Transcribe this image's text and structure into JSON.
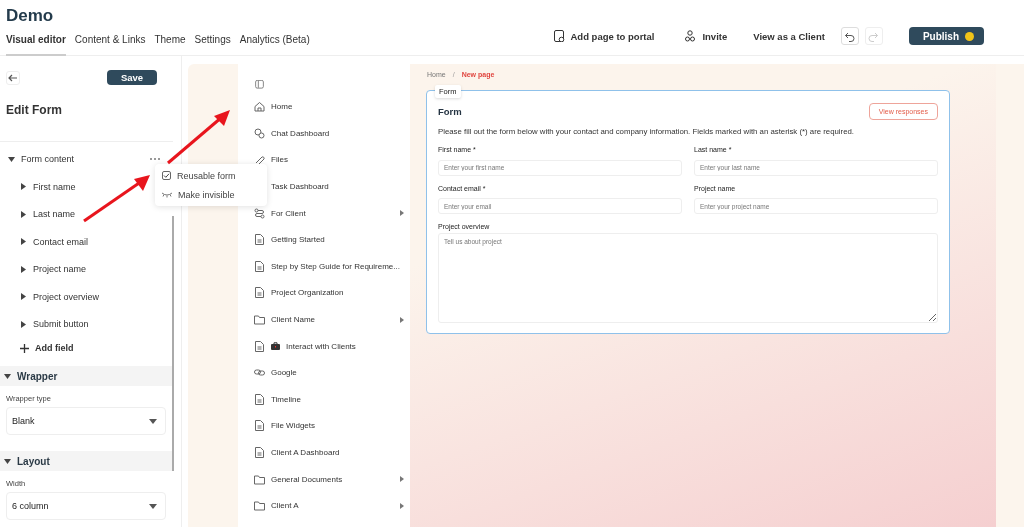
{
  "app": {
    "title": "Demo"
  },
  "tabs": [
    {
      "label": "Visual editor",
      "selected": true
    },
    {
      "label": "Content & Links",
      "selected": false
    },
    {
      "label": "Theme",
      "selected": false
    },
    {
      "label": "Settings",
      "selected": false
    },
    {
      "label": "Analytics (Beta)",
      "selected": false
    }
  ],
  "actions": [
    {
      "kind": "portal",
      "label": "Add page to portal"
    },
    {
      "kind": "invite",
      "label": "Invite"
    },
    {
      "kind": "plain",
      "label": "View as a Client"
    }
  ],
  "history": [
    {
      "kind": "undo",
      "disabled": false
    },
    {
      "kind": "redo",
      "disabled": true
    }
  ],
  "publish": {
    "label": "Publish",
    "color": "#f2c418"
  },
  "editor": {
    "save": "Save",
    "heading": "Edit Form",
    "tree": {
      "label": "Form content",
      "expanded": true,
      "children": [
        {
          "label": "First name",
          "expanded": false
        },
        {
          "label": "Last name",
          "expanded": false
        },
        {
          "label": "Contact email",
          "expanded": false
        },
        {
          "label": "Project name",
          "expanded": false
        },
        {
          "label": "Project overview",
          "expanded": false
        },
        {
          "label": "Submit button",
          "expanded": false
        }
      ],
      "add": "Add field"
    },
    "sections": [
      {
        "title": "Wrapper",
        "expanded": true,
        "field_label": "Wrapper type",
        "value": "Blank"
      },
      {
        "title": "Layout",
        "expanded": true,
        "field_label": "Width",
        "value": "6 column"
      }
    ]
  },
  "menu": [
    {
      "kind": "checkbox",
      "label": "Reusable form",
      "checked": true
    },
    {
      "kind": "hide",
      "label": "Make invisible"
    }
  ],
  "nav": [
    {
      "kind": "home",
      "label": "Home",
      "expandable": false
    },
    {
      "kind": "chat",
      "label": "Chat Dashboard",
      "expandable": false
    },
    {
      "kind": "files",
      "label": "Files",
      "expandable": false
    },
    {
      "kind": "covered",
      "label": "Task Dashboard",
      "expandable": false
    },
    {
      "kind": "share",
      "label": "For Client",
      "expandable": true
    },
    {
      "kind": "page",
      "label": "Getting Started",
      "expandable": false
    },
    {
      "kind": "page",
      "label": "Step by Step Guide for Requireme...",
      "expandable": false
    },
    {
      "kind": "page",
      "label": "Project Organization",
      "expandable": false
    },
    {
      "kind": "folder",
      "label": "Client Name",
      "expandable": true
    },
    {
      "kind": "page",
      "label": "Interact with Clients",
      "expandable": false,
      "briefcase": true
    },
    {
      "kind": "link",
      "label": "Google",
      "expandable": false
    },
    {
      "kind": "page",
      "label": "Timeline",
      "expandable": false
    },
    {
      "kind": "page",
      "label": "File Widgets",
      "expandable": false
    },
    {
      "kind": "page",
      "label": "Client A Dashboard",
      "expandable": false
    },
    {
      "kind": "folder",
      "label": "General Documents",
      "expandable": true
    },
    {
      "kind": "folder",
      "label": "Client A",
      "expandable": true
    }
  ],
  "breadcrumb_separator": "/",
  "breadcrumb": [
    {
      "label": "Home",
      "selected": false
    },
    {
      "label": "New page",
      "selected": true
    }
  ],
  "form": {
    "tag": "Form",
    "title": "Form",
    "responses": "View responses",
    "intro": "Please fill out the form below with your contact and company information. Fields marked with an asterisk (*) are required.",
    "fields": [
      {
        "kind": "input",
        "label": "First name *",
        "placeholder": "Enter your first name"
      },
      {
        "kind": "input",
        "label": "Last name *",
        "placeholder": "Enter your last name"
      },
      {
        "kind": "input",
        "label": "Contact email *",
        "placeholder": "Enter your email"
      },
      {
        "kind": "input",
        "label": "Project name",
        "placeholder": "Enter your project name"
      },
      {
        "kind": "textarea",
        "label": "Project overview",
        "placeholder": "Tell us about project"
      }
    ]
  }
}
